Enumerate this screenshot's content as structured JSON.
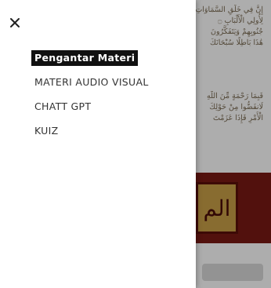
{
  "drawer": {
    "close_icon": "close-icon",
    "items": [
      {
        "label": "Pengantar Materi",
        "active": true
      },
      {
        "label": "MATERI AUDIO VISUAL",
        "active": false
      },
      {
        "label": "CHATT GPT",
        "active": false
      },
      {
        "label": "KUIZ",
        "active": false
      }
    ]
  },
  "background": {
    "paragraph_1": [
      "إِنَّ فِي خَلْقِ السَّمَاوَاتِ",
      "لِأُولِي الْأَلْبَابِ ۝",
      "جُنُوبِهِمْ وَيَتَفَكَّرُونَ",
      "هَٰذَا بَاطِلًا سُبْحَانَكَ"
    ],
    "paragraph_2": [
      "فَبِمَا رَحْمَةٍ مِّنَ اللَّهِ",
      "لَانفَضُّوا مِنْ حَوْلِكَ",
      "الْأَمْرِ فَإِذَا عَزَمْتَ"
    ],
    "cover_glyph": "الم"
  },
  "colors": {
    "active_bg": "#111111",
    "active_text": "#ffffff",
    "text": "#333333",
    "cover": "#7a1a14"
  }
}
